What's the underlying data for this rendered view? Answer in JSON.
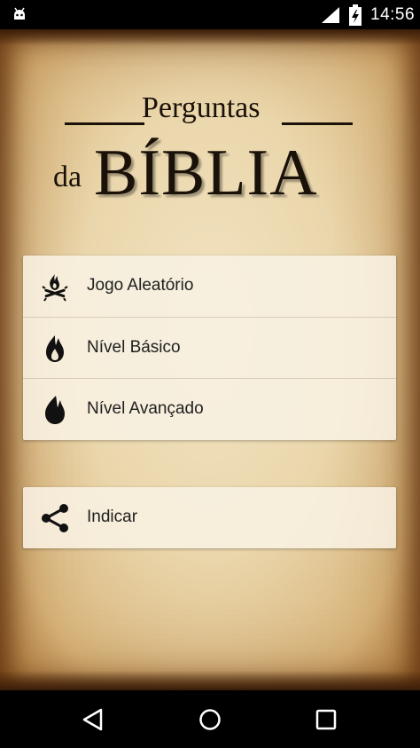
{
  "status_bar": {
    "time": "14:56",
    "icons": [
      "android-icon",
      "signal-icon",
      "battery-icon"
    ]
  },
  "logo": {
    "line1": "Perguntas",
    "line2_prefix": "da",
    "line2_main": "BÍBLIA"
  },
  "menu": {
    "items": [
      {
        "label": "Jogo Aleatório",
        "icon": "campfire-icon"
      },
      {
        "label": "Nível Básico",
        "icon": "flame-small-icon"
      },
      {
        "label": "Nível Avançado",
        "icon": "flame-large-icon"
      }
    ]
  },
  "share": {
    "label": "Indicar",
    "icon": "share-icon"
  },
  "nav_bar": {
    "buttons": [
      "back-icon",
      "home-icon",
      "recents-icon"
    ]
  },
  "colors": {
    "parchment": "#ead6ab",
    "card": "#f8f1e2",
    "text": "#202020",
    "logo_ink": "#1a1208"
  }
}
